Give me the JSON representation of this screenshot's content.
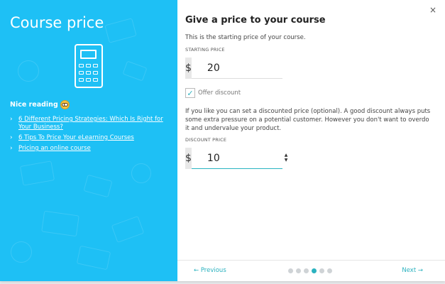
{
  "backdrop_text": "course.",
  "left": {
    "title": "Course price",
    "reading_title": "Nice reading",
    "links": [
      "6 Different Pricing Strategies: Which Is Right for Your Business?",
      "6 Tips To Price Your eLearning Courses",
      "Pricing an online course"
    ]
  },
  "right": {
    "close": "×",
    "title": "Give a price to your course",
    "subtitle": "This is the starting price of your course.",
    "starting_price_label": "STARTING PRICE",
    "currency": "$",
    "starting_price": "20",
    "offer_discount_label": "Offer discount",
    "offer_discount_checked": true,
    "paragraph": "If you like you can set a discounted price (optional). A good discount always puts some extra pressure on a potential customer. However you don't want to overdo it and undervalue your product.",
    "discount_price_label": "DISCOUNT PRICE",
    "discount_price": "10",
    "spinner_up": "▲",
    "spinner_down": "▼"
  },
  "footer": {
    "previous": "← Previous",
    "next": "Next →",
    "steps_total": 6,
    "current_step": 4
  },
  "colors": {
    "left_panel": "#1ec0f5",
    "accent": "#2bb2bf"
  }
}
